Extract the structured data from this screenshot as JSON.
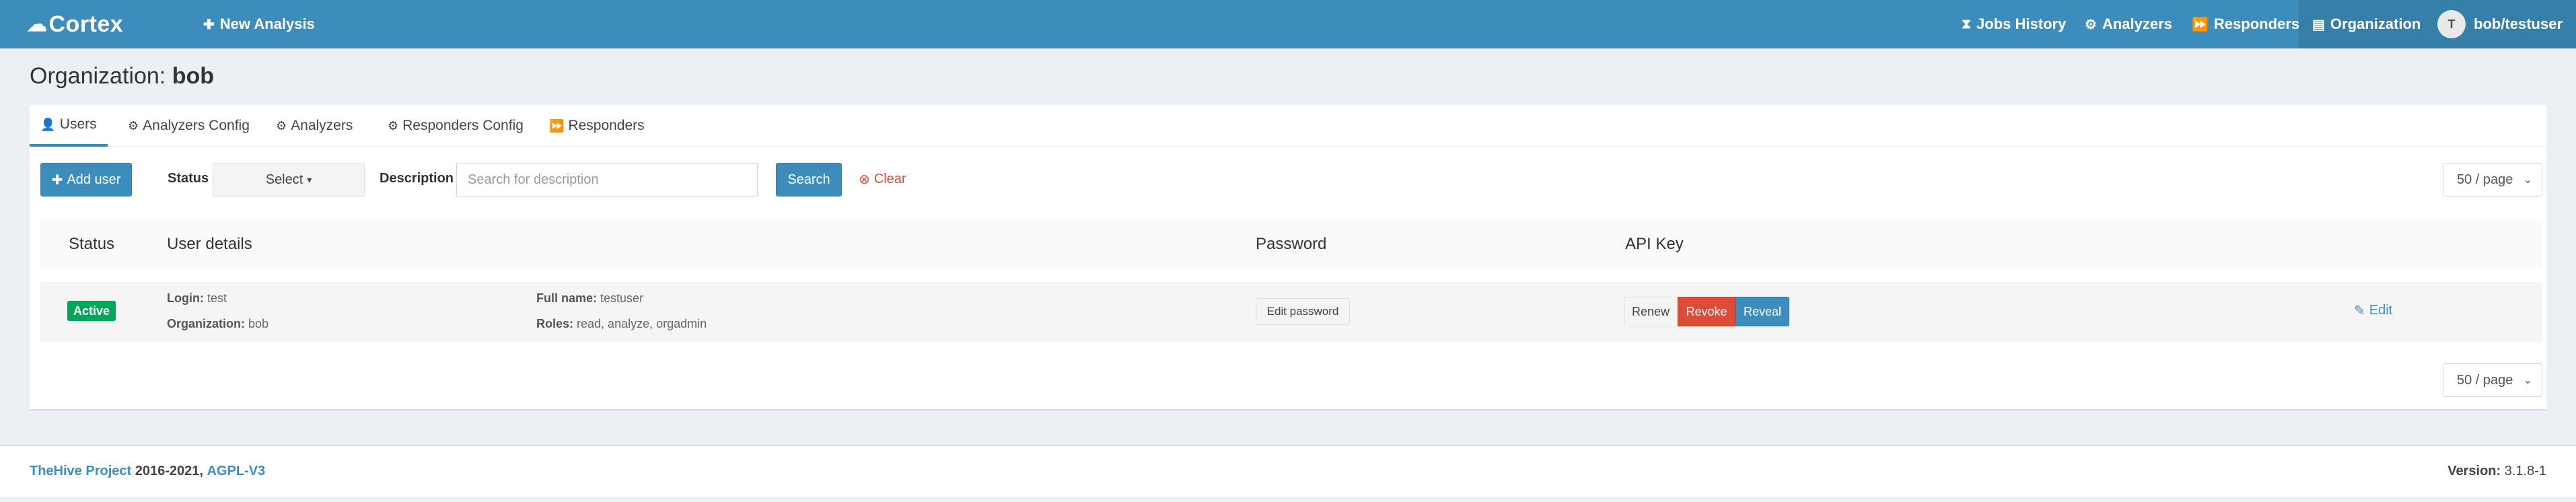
{
  "navbar": {
    "brand": "Cortex",
    "new_analysis": "New Analysis",
    "jobs_history": "Jobs History",
    "analyzers": "Analyzers",
    "responders": "Responders",
    "organization": "Organization",
    "user_initial": "T",
    "user": "bob/testuser"
  },
  "page": {
    "title_prefix": "Organization:",
    "title_org": "bob"
  },
  "tabs": [
    {
      "label": "Users",
      "icon": "user-icon",
      "active": true
    },
    {
      "label": "Analyzers Config",
      "icon": "cog-icon"
    },
    {
      "label": "Analyzers",
      "icon": "cogs-icon"
    },
    {
      "label": "Responders Config",
      "icon": "cog-icon"
    },
    {
      "label": "Responders",
      "icon": "forward-icon"
    }
  ],
  "toolbar": {
    "add_user": "Add user",
    "status_label": "Status",
    "status_select": "Select",
    "description_label": "Description",
    "description_placeholder": "Search for description",
    "search": "Search",
    "clear": "Clear",
    "page_size": "50 / page"
  },
  "table": {
    "headers": [
      "Status",
      "User details",
      "Password",
      "API Key"
    ],
    "rows": [
      {
        "status": "Active",
        "login_label": "Login:",
        "login": "test",
        "org_label": "Organization:",
        "org": "bob",
        "fullname_label": "Full name:",
        "fullname": "testuser",
        "roles_label": "Roles:",
        "roles": "read, analyze, orgadmin",
        "edit_password": "Edit password",
        "renew": "Renew",
        "revoke": "Revoke",
        "reveal": "Reveal",
        "edit": "Edit"
      }
    ]
  },
  "footer": {
    "project": "TheHive Project",
    "years": "2016-2021,",
    "license": "AGPL-V3",
    "version_label": "Version:",
    "version": "3.1.8-1"
  },
  "colors": {
    "primary": "#3c8dbc",
    "danger": "#dd4b39",
    "success": "#00a65a",
    "background": "#ecf0f5"
  }
}
